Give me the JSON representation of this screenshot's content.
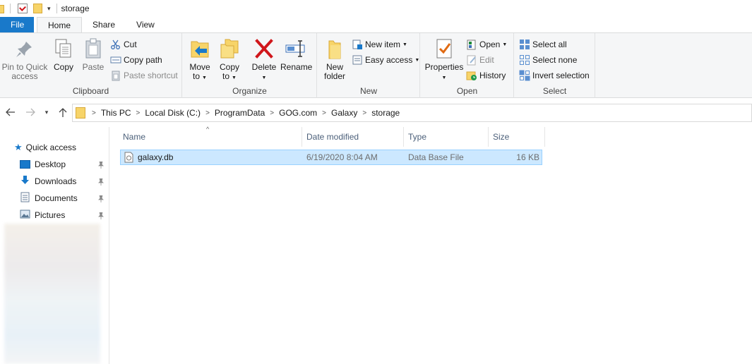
{
  "window": {
    "title": "storage"
  },
  "ribbon_tabs": [
    "File",
    "Home",
    "Share",
    "View"
  ],
  "clipboard": {
    "label": "Clipboard",
    "pin": "Pin to Quick access",
    "pin_l1": "Pin to Quick",
    "pin_l2": "access",
    "copy": "Copy",
    "paste": "Paste",
    "cut": "Cut",
    "copy_path": "Copy path",
    "paste_shortcut": "Paste shortcut"
  },
  "organize": {
    "label": "Organize",
    "move_l1": "Move",
    "move_l2": "to",
    "copy_l1": "Copy",
    "copy_l2": "to",
    "delete": "Delete",
    "rename": "Rename"
  },
  "new_group": {
    "label": "New",
    "new_folder_l1": "New",
    "new_folder_l2": "folder",
    "new_item": "New item",
    "easy_access": "Easy access"
  },
  "open_group": {
    "label": "Open",
    "properties": "Properties",
    "open": "Open",
    "edit": "Edit",
    "history": "History"
  },
  "select_group": {
    "label": "Select",
    "select_all": "Select all",
    "select_none": "Select none",
    "invert_selection": "Invert selection"
  },
  "breadcrumb": [
    "This PC",
    "Local Disk (C:)",
    "ProgramData",
    "GOG.com",
    "Galaxy",
    "storage"
  ],
  "sidebar": {
    "quick_access": "Quick access",
    "items": [
      "Desktop",
      "Downloads",
      "Documents",
      "Pictures"
    ]
  },
  "columns": [
    "Name",
    "Date modified",
    "Type",
    "Size"
  ],
  "files": [
    {
      "name": "galaxy.db",
      "date": "6/19/2020 8:04 AM",
      "type": "Data Base File",
      "size": "16 KB"
    }
  ],
  "colors": {
    "file_tab": "#1979ca",
    "selection": "#cce8ff",
    "selection_border": "#99d1ff",
    "folder": "#f7d469",
    "delete_red": "#d0161b"
  },
  "icons": {
    "pin": "pin-icon",
    "copy": "copy-icon",
    "paste": "paste-icon",
    "cut": "scissors-icon",
    "move_to": "move-to-icon",
    "copy_to": "copy-to-icon",
    "delete": "delete-x-icon",
    "rename": "rename-icon",
    "new_folder": "new-folder-icon",
    "properties": "properties-icon",
    "history": "history-icon"
  }
}
